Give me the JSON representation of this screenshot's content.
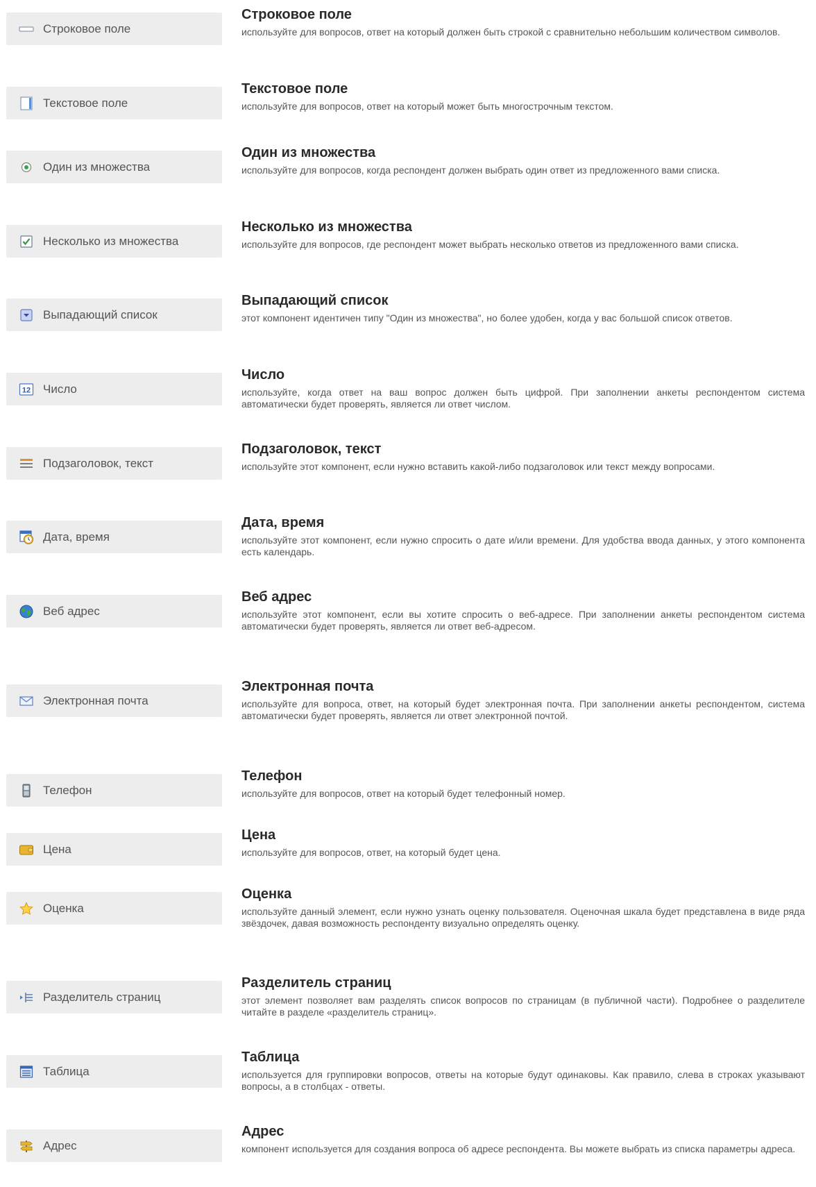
{
  "components": [
    {
      "icon": "text-field-icon",
      "label": "Строковое поле",
      "title": "Строковое поле",
      "description": "используйте для вопросов, ответ на который должен быть строкой с сравнительно небольшим количеством символов."
    },
    {
      "icon": "textarea-icon",
      "label": "Текстовое поле",
      "title": "Текстовое поле",
      "description": "используйте для вопросов, ответ на который может быть многострочным текстом."
    },
    {
      "icon": "radio-icon",
      "label": "Один из множества",
      "title": "Один из множества",
      "description": "используйте для вопросов, когда респондент должен выбрать один ответ из предложенного вами списка."
    },
    {
      "icon": "checkbox-icon",
      "label": "Несколько из множества",
      "title": "Несколько из множества",
      "description": "используйте для вопросов, где респондент может выбрать несколько ответов из предложенного вами списка."
    },
    {
      "icon": "dropdown-icon",
      "label": "Выпадающий список",
      "title": "Выпадающий список",
      "description": "этот компонент идентичен типу \"Один из множества\", но более удобен, когда у вас большой список ответов."
    },
    {
      "icon": "number-icon",
      "icon_text": "12",
      "label": "Число",
      "title": "Число",
      "description": "используйте, когда ответ на ваш вопрос должен быть цифрой. При заполнении анкеты респондентом система автоматически будет проверять, является ли ответ числом."
    },
    {
      "icon": "subtitle-lines-icon",
      "label": "Подзаголовок, текст",
      "title": "Подзаголовок, текст",
      "description": "используйте этот компонент, если нужно вставить какой-либо подзаголовок или текст между вопросами."
    },
    {
      "icon": "calendar-clock-icon",
      "label": "Дата, время",
      "title": "Дата, время",
      "description": "используйте этот компонент, если нужно спросить о дате и/или времени. Для удобства ввода данных, у этого компонента есть календарь."
    },
    {
      "icon": "globe-icon",
      "label": "Веб адрес",
      "title": "Веб адрес",
      "description": "используйте этот компонент, если вы хотите спросить о веб-адресе. При заполнении анкеты респондентом система автоматически будет проверять, является ли ответ веб-адресом."
    },
    {
      "icon": "envelope-icon",
      "label": "Электронная почта",
      "title": "Электронная почта",
      "description": "используйте для вопроса, ответ, на который будет электронная почта. При заполнении анкеты респондентом, система автоматически будет проверять, является ли ответ электронной почтой."
    },
    {
      "icon": "phone-icon",
      "label": "Телефон",
      "title": "Телефон",
      "description": "используйте для вопросов, ответ на который будет телефонный номер."
    },
    {
      "icon": "price-icon",
      "label": "Цена",
      "title": "Цена",
      "description": "используйте для вопросов, ответ, на который будет цена."
    },
    {
      "icon": "star-icon",
      "label": "Оценка",
      "title": "Оценка",
      "description": "используйте данный элемент, если нужно узнать оценку пользователя. Оценочная шкала будет представлена в виде ряда звёздочек, давая возможность респонденту визуально определять оценку."
    },
    {
      "icon": "page-separator-icon",
      "label": "Разделитель страниц",
      "title": "Разделитель страниц",
      "description": "этот элемент позволяет вам разделять список вопросов по страницам (в публичной части). Подробнее о разделителе читайте в разделе «разделитель страниц»."
    },
    {
      "icon": "table-icon",
      "label": "Таблица",
      "title": "Таблица",
      "description": "используется для группировки вопросов, ответы на которые будут одинаковы. Как правило, слева в строках указывают вопросы, а в столбцах - ответы."
    },
    {
      "icon": "signpost-icon",
      "label": "Адрес",
      "title": "Адрес",
      "description": "компонент используется для создания вопроса об адресе респондента. Вы можете выбрать из списка параметры адреса."
    }
  ]
}
